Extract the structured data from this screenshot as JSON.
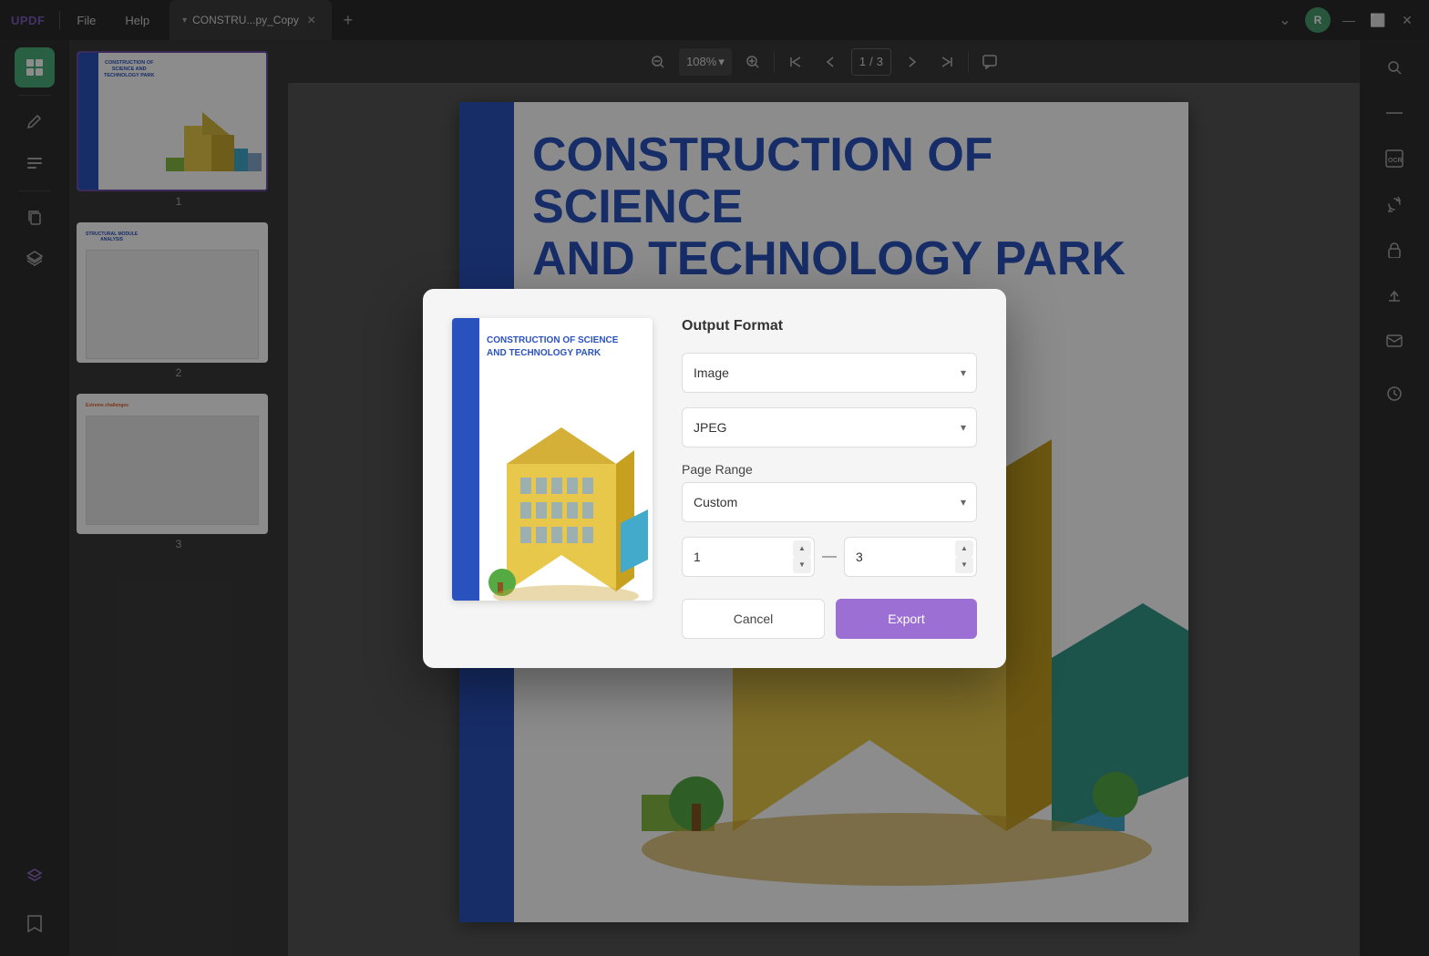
{
  "app": {
    "logo": "UPDF",
    "tab_title": "CONSTRU...py_Copy",
    "menu_items": [
      "File",
      "Help"
    ]
  },
  "toolbar": {
    "zoom_level": "108%",
    "page_current": "1",
    "page_total": "3",
    "zoom_dropdown_arrow": "▾"
  },
  "sidebar": {
    "icons": [
      "grid",
      "pen",
      "list",
      "copy",
      "layers"
    ]
  },
  "thumbnail_pages": [
    {
      "label": "1"
    },
    {
      "label": "2"
    },
    {
      "label": "3"
    }
  ],
  "modal": {
    "output_format_label": "Output Format",
    "format_value": "Image",
    "subformat_value": "JPEG",
    "page_range_label": "Page Range",
    "page_range_value": "Custom",
    "page_start": "1",
    "page_end": "3",
    "cancel_label": "Cancel",
    "export_label": "Export"
  },
  "preview": {
    "title_line1": "CONSTRUCTION OF SCIENCE",
    "title_line2": "AND TECHNOLOGY PARK"
  }
}
